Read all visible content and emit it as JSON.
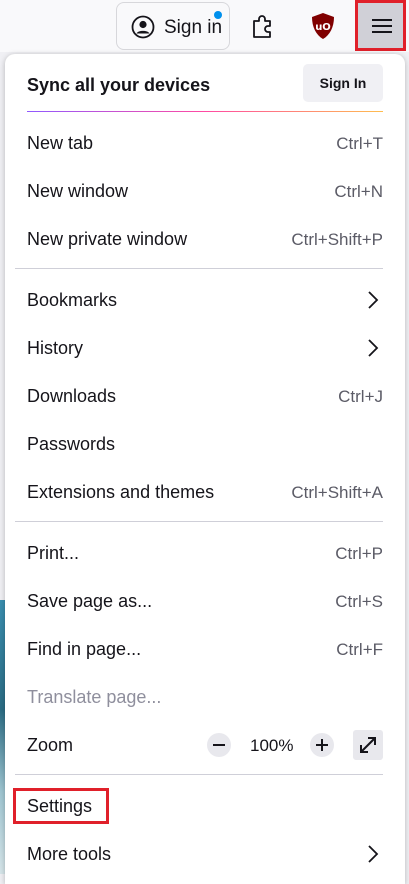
{
  "toolbar": {
    "sign_in_label": "Sign in",
    "icons": [
      "account-icon",
      "extensions-icon",
      "ublock-origin-icon",
      "hamburger-menu-icon"
    ],
    "notification_dot_color": "#0090ed",
    "highlight_color": "#e0202a"
  },
  "sync": {
    "title": "Sync all your devices",
    "button_label": "Sign In"
  },
  "menu": {
    "new_tab": {
      "label": "New tab",
      "shortcut": "Ctrl+T"
    },
    "new_window": {
      "label": "New window",
      "shortcut": "Ctrl+N"
    },
    "new_private_window": {
      "label": "New private window",
      "shortcut": "Ctrl+Shift+P"
    },
    "bookmarks": {
      "label": "Bookmarks"
    },
    "history": {
      "label": "History"
    },
    "downloads": {
      "label": "Downloads",
      "shortcut": "Ctrl+J"
    },
    "passwords": {
      "label": "Passwords"
    },
    "extensions_themes": {
      "label": "Extensions and themes",
      "shortcut": "Ctrl+Shift+A"
    },
    "print": {
      "label": "Print...",
      "shortcut": "Ctrl+P"
    },
    "save_page": {
      "label": "Save page as...",
      "shortcut": "Ctrl+S"
    },
    "find_in_page": {
      "label": "Find in page...",
      "shortcut": "Ctrl+F"
    },
    "translate_page": {
      "label": "Translate page...",
      "disabled": true
    },
    "zoom": {
      "label": "Zoom",
      "value": "100%"
    },
    "settings": {
      "label": "Settings"
    },
    "more_tools": {
      "label": "More tools"
    }
  }
}
